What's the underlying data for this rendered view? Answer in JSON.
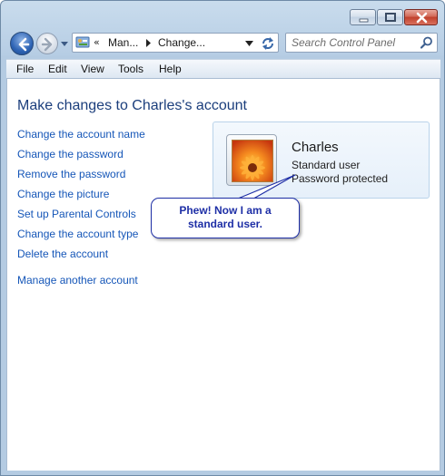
{
  "window": {
    "buttons": {
      "minimize": "minimize-icon",
      "maximize": "maximize-icon",
      "close": "close-icon"
    }
  },
  "nav": {
    "back_icon": "back-arrow-icon",
    "forward_icon": "forward-arrow-icon",
    "recent_pages_icon": "chevron-down-icon"
  },
  "address": {
    "icon": "control-panel-icon",
    "overflow": "«",
    "segments": [
      "Man...",
      "Change..."
    ],
    "dropdown_icon": "chevron-down-icon",
    "refresh_icon": "refresh-icon"
  },
  "search": {
    "placeholder": "Search Control Panel",
    "icon": "search-icon"
  },
  "menu": {
    "items": [
      "File",
      "Edit",
      "View",
      "Tools",
      "Help"
    ]
  },
  "main": {
    "title": "Make changes to Charles's account",
    "links": [
      "Change the account name",
      "Change the password",
      "Remove the password",
      "Change the picture",
      "Set up Parental Controls",
      "Change the account type",
      "Delete the account",
      "Manage another account"
    ],
    "account": {
      "name": "Charles",
      "type": "Standard user",
      "password_status": "Password protected",
      "picture_icon": "flower-picture"
    }
  },
  "callout": {
    "line1": "Phew! Now I am a",
    "line2": "standard user."
  },
  "colors": {
    "link": "#1556b8",
    "title": "#1b3e7c",
    "callout": "#1e2fa6"
  }
}
